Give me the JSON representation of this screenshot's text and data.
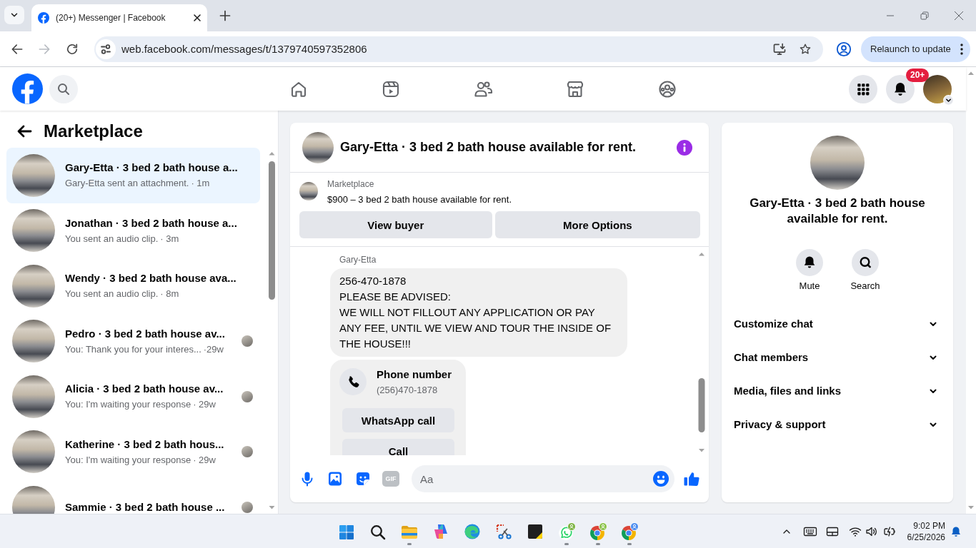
{
  "browser": {
    "tabs": [
      {
        "title": "(20+) Messenger | Facebook",
        "selected": true
      }
    ],
    "forward_disabled": true,
    "url": "web.facebook.com/messages/t/1379740597352806",
    "relaunch_button": "Relaunch to update"
  },
  "header": {
    "notification_badge": "20+"
  },
  "sidebar": {
    "title": "Marketplace",
    "conversations": [
      {
        "title": "Gary-Etta · 3 bed 2 bath house a...",
        "preview": "Gary-Etta sent an attachment.",
        "time": "· 1m",
        "selected": true,
        "seen_avatar": false
      },
      {
        "title": "Jonathan · 3 bed 2 bath house a...",
        "preview": "You sent an audio clip.",
        "time": "· 3m",
        "selected": false,
        "seen_avatar": false
      },
      {
        "title": "Wendy · 3 bed 2 bath house ava...",
        "preview": "You sent an audio clip.",
        "time": "· 8m",
        "selected": false,
        "seen_avatar": false
      },
      {
        "title": "Pedro · 3 bed 2 bath house av...",
        "preview": "You: Thank you for your interes...",
        "time": "·29w",
        "selected": false,
        "seen_avatar": true
      },
      {
        "title": "Alicia · 3 bed 2 bath house av...",
        "preview": "You: I'm waiting your response",
        "time": "· 29w",
        "selected": false,
        "seen_avatar": true
      },
      {
        "title": "Katherine · 3 bed 2 bath hous...",
        "preview": "You: I'm waiting your response",
        "time": "· 29w",
        "selected": false,
        "seen_avatar": true
      },
      {
        "title": "Sammie · 3 bed 2 bath house ...",
        "selected": false,
        "seen_avatar": true
      }
    ]
  },
  "chat": {
    "title": "Gary-Etta · 3 bed 2 bath house available for rent.",
    "listing": {
      "label": "Marketplace",
      "text": "$900 – 3 bed 2 bath house available for rent.",
      "buttons": [
        "View buyer",
        "More Options"
      ]
    },
    "messages": [
      {
        "kind": "text",
        "sender": "Gary-Etta",
        "text": "256-470-1878\nPLEASE BE ADVISED:\nWE WILL NOT FILLOUT ANY APPLICATION OR PAY ANY FEE, UNTIL WE VIEW AND TOUR THE INSIDE OF THE HOUSE!!!"
      },
      {
        "kind": "contact",
        "title": "Phone number",
        "value": "(256)470-1878",
        "buttons": [
          "WhatsApp call",
          "Call"
        ]
      }
    ],
    "composer": {
      "gif_label": "GIF",
      "gif_disabled": true,
      "placeholder": "Aa"
    }
  },
  "details": {
    "title": "Gary-Etta · 3 bed 2 bath house available for rent.",
    "actions": [
      "Mute",
      "Search"
    ],
    "sections": [
      {
        "label": "Customize chat",
        "expanded": false
      },
      {
        "label": "Chat members",
        "expanded": false
      },
      {
        "label": "Media, files and links",
        "expanded": false
      },
      {
        "label": "Privacy & support",
        "expanded": false
      }
    ]
  },
  "taskbar": {
    "apps": [
      {
        "running": false
      },
      {
        "running": false
      },
      {
        "running": true
      },
      {
        "running": false
      },
      {
        "running": false
      },
      {
        "running": false
      },
      {
        "running": false
      },
      {
        "running": true
      },
      {
        "running": true
      },
      {
        "running": true
      }
    ],
    "time": "9:02 PM",
    "date": "6/25/2026"
  }
}
